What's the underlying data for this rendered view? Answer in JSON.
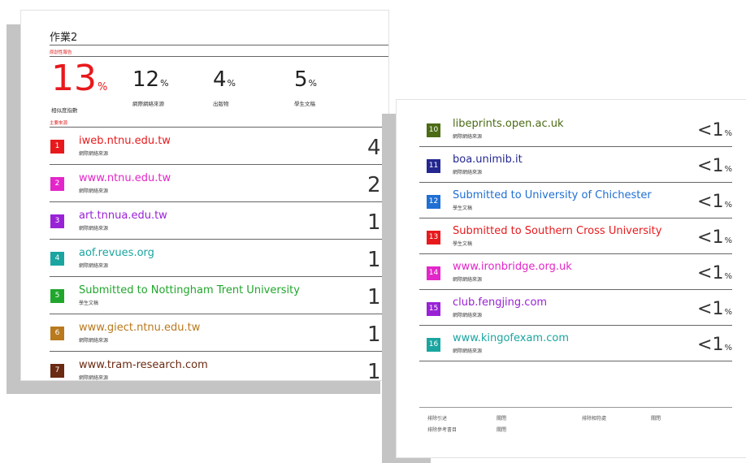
{
  "title": "作業2",
  "report_label": "原創性報告",
  "stats": [
    {
      "value": "13",
      "unit": "%",
      "label": "相似度指數"
    },
    {
      "value": "12",
      "unit": "%",
      "label": "網際網絡來源"
    },
    {
      "value": "4",
      "unit": "%",
      "label": "出版物"
    },
    {
      "value": "5",
      "unit": "%",
      "label": "學生文稿"
    }
  ],
  "sources_label": "主要來源",
  "colors": {
    "accent_red": "#e8191c",
    "rule": "#666666",
    "paper_shadow": "#c4c4c4"
  },
  "sources": [
    {
      "num": "1",
      "source": "iweb.ntnu.edu.tw",
      "type": "網際網絡來源",
      "value": "4",
      "unit": "%",
      "color": "#e8191c"
    },
    {
      "num": "2",
      "source": "www.ntnu.edu.tw",
      "type": "網際網絡來源",
      "value": "2",
      "unit": "%",
      "color": "#e326c9"
    },
    {
      "num": "3",
      "source": "art.tnnua.edu.tw",
      "type": "網際網絡來源",
      "value": "1",
      "unit": "%",
      "color": "#9a22d6"
    },
    {
      "num": "4",
      "source": "aof.revues.org",
      "type": "網際網絡來源",
      "value": "1",
      "unit": "%",
      "color": "#1aa5a0"
    },
    {
      "num": "5",
      "source": "Submitted to Nottingham Trent University",
      "type": "學生文稿",
      "value": "1",
      "unit": "%",
      "color": "#20a62c"
    },
    {
      "num": "6",
      "source": "www.giect.ntnu.edu.tw",
      "type": "網際網絡來源",
      "value": "1",
      "unit": "%",
      "color": "#b9791d"
    },
    {
      "num": "7",
      "source": "www.tram-research.com",
      "type": "網際網絡來源",
      "value": "1",
      "unit": "%",
      "color": "#6b2a12"
    },
    {
      "num": "10",
      "source": "libeprints.open.ac.uk",
      "type": "網際網絡來源",
      "value": "<1",
      "unit": "%",
      "color": "#4b6b15"
    },
    {
      "num": "11",
      "source": "boa.unimib.it",
      "type": "網際網絡來源",
      "value": "<1",
      "unit": "%",
      "color": "#24278f"
    },
    {
      "num": "12",
      "source": "Submitted to University of Chichester",
      "type": "學生文稿",
      "value": "<1",
      "unit": "%",
      "color": "#1f6fd4"
    },
    {
      "num": "13",
      "source": "Submitted to Southern Cross University",
      "type": "學生文稿",
      "value": "<1",
      "unit": "%",
      "color": "#e8191c"
    },
    {
      "num": "14",
      "source": "www.ironbridge.org.uk",
      "type": "網際網絡來源",
      "value": "<1",
      "unit": "%",
      "color": "#e326c9"
    },
    {
      "num": "15",
      "source": "club.fengjing.com",
      "type": "網際網絡來源",
      "value": "<1",
      "unit": "%",
      "color": "#9a22d6"
    },
    {
      "num": "16",
      "source": "www.kingofexam.com",
      "type": "網際網絡來源",
      "value": "<1",
      "unit": "%",
      "color": "#1aa5a0"
    }
  ],
  "footer": {
    "exclude_quotes_label": "排除引述",
    "exclude_quotes_value": "關閉",
    "exclude_bibliography_label": "排除參考書目",
    "exclude_bibliography_value": "關閉",
    "exclude_matches_label": "排除相符處",
    "exclude_matches_value": "關閉"
  }
}
